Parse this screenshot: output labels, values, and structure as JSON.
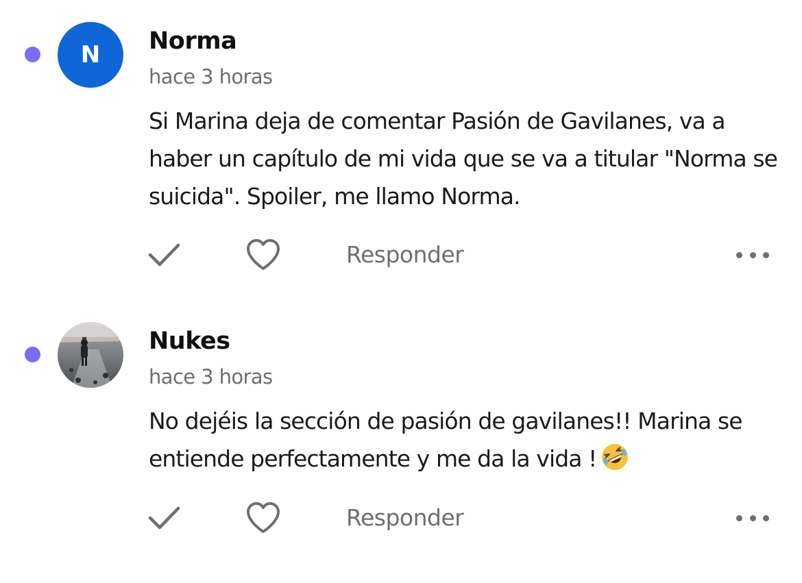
{
  "colors": {
    "unread_dot": "#7b6cf6",
    "avatar_initial_bg": "#0f66d6",
    "text_primary": "#1a1a1a",
    "text_secondary": "#6e6e6e",
    "icon": "#6e6e6e"
  },
  "comments": [
    {
      "author": "Norma",
      "avatar_initial": "N",
      "avatar_type": "initial",
      "timestamp": "hace 3 horas",
      "text": "Si Marina deja de comentar Pasión de Gavilanes, va a haber un capítulo de mi vida que se va a titular \"Norma se suicida\". Spoiler, me llamo Norma.",
      "unread": true,
      "actions": {
        "check_icon": "check-icon",
        "like_icon": "heart-outline-icon",
        "reply_label": "Responder",
        "more_icon": "more-horizontal-icon"
      }
    },
    {
      "author": "Nukes",
      "avatar_type": "photo",
      "timestamp": "hace 3 horas",
      "text": "No dejéis la sección de pasión de gavilanes!! Marina se entiende perfectamente y me da la vida !",
      "emoji": "rolling-on-floor-laughing-emoji",
      "unread": true,
      "actions": {
        "check_icon": "check-icon",
        "like_icon": "heart-outline-icon",
        "reply_label": "Responder",
        "more_icon": "more-horizontal-icon"
      }
    }
  ]
}
